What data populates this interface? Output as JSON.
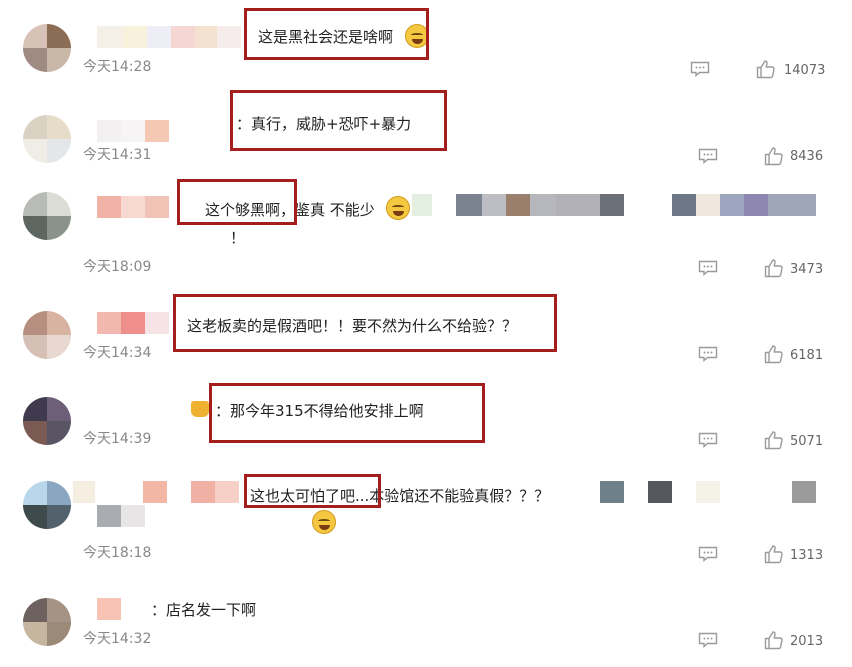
{
  "comments": [
    {
      "text": "这是黑社会还是啥啊",
      "time": "今天14:28",
      "likes": "14073"
    },
    {
      "text": "：真行，威胁+恐吓+暴力",
      "time": "今天14:31",
      "likes": "8436"
    },
    {
      "text": "这个够黑啊，鉴真 不能少",
      "extra": "！",
      "time": "今天18:09",
      "likes": "3473"
    },
    {
      "text": "这老板卖的是假酒吧！！要不然为什么不给验？？",
      "time": "今天14:34",
      "likes": "6181"
    },
    {
      "text": "：那今年315不得给他安排上啊",
      "time": "今天14:39",
      "likes": "5071"
    },
    {
      "text": "这也太可怕了吧...本验馆还不能验真假？？？",
      "time": "今天18:18",
      "likes": "1313"
    },
    {
      "text": "：店名发一下啊",
      "time": "今天14:32",
      "likes": "2013"
    }
  ],
  "colors": {
    "highlight": "#a51e1e",
    "time": "#888888",
    "icon": "#9a9a9a"
  },
  "icons": {
    "reply": "comment-bubble-icon",
    "like": "thumbs-up-icon"
  }
}
